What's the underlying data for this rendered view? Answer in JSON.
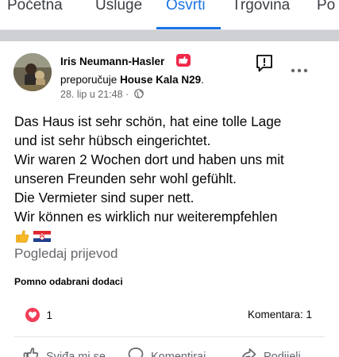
{
  "tabs": [
    {
      "label": "Početna"
    },
    {
      "label": "Usluge"
    },
    {
      "label": "Osvrti"
    },
    {
      "label": "Trgovina"
    },
    {
      "label": "Po"
    }
  ],
  "active_tab": "Osvrti",
  "post": {
    "author": "Iris Neumann-Hasler",
    "recommends_prefix": "preporučuje",
    "page_name": "House Kala N29",
    "page_suffix": ".",
    "timestamp": "28. lip u 21:48",
    "separator": "·",
    "lines": [
      "Das Haus ist sehr schön, hat eine tolle Lage",
      "und ist sehr hübsch eingerichtet.",
      "Wir waren 2 Wochen dort und haben uns mit",
      "unseren Freunden sehr wohl gefühlt.",
      "Die Vermieter sind super nett.",
      "Wir können es wirklich nur weiterempfehlen"
    ],
    "emojis": [
      "thumbs-up-icon",
      "croatia-flag-icon"
    ],
    "see_translation": "Pogledaj prijevod",
    "highlights_label": "Pomno odabrani dodaci",
    "reaction_count": "1",
    "comments_label": "Komentara: 1"
  },
  "actions": {
    "like": "Sviđa mi se",
    "comment": "Komentiraj",
    "share": "Podijeli"
  },
  "colors": {
    "accent": "#1b74e4",
    "heart": "#f33e58",
    "badge": "#f02849",
    "muted": "#65676b"
  }
}
